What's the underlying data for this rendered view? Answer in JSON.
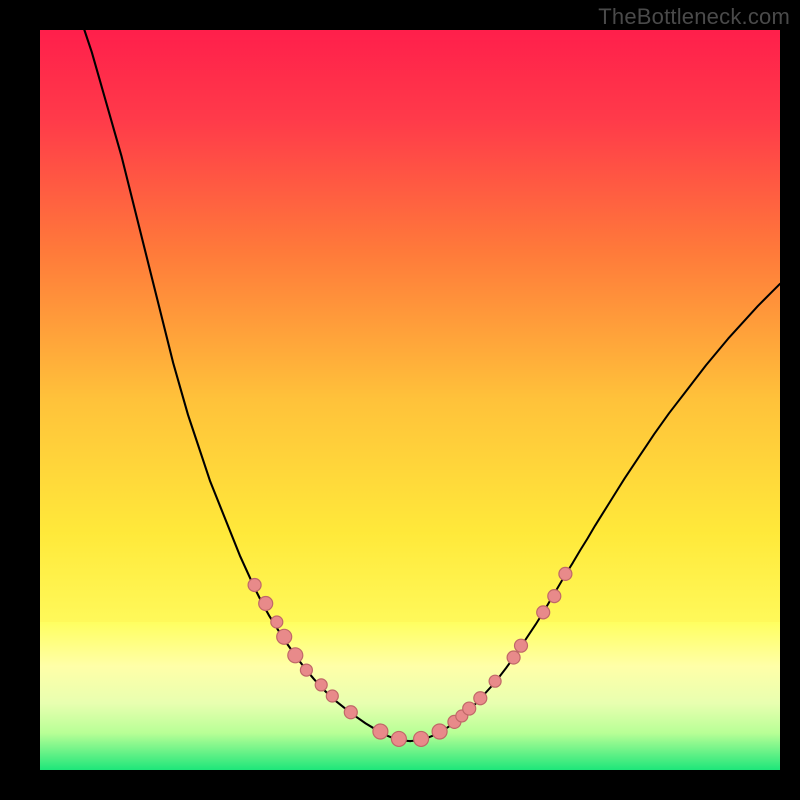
{
  "watermark": "TheBottleneck.com",
  "chart_data": {
    "type": "line",
    "title": "",
    "xlabel": "",
    "ylabel": "",
    "xlim": [
      0,
      100
    ],
    "ylim": [
      0,
      100
    ],
    "background_gradient": {
      "stops": [
        {
          "offset": 0.0,
          "color": "#ff1f4b"
        },
        {
          "offset": 0.12,
          "color": "#ff3a4a"
        },
        {
          "offset": 0.3,
          "color": "#ff7a3a"
        },
        {
          "offset": 0.5,
          "color": "#ffc23a"
        },
        {
          "offset": 0.68,
          "color": "#ffe93a"
        },
        {
          "offset": 0.8,
          "color": "#fff95a"
        },
        {
          "offset": 0.86,
          "color": "#ffffa8"
        },
        {
          "offset": 0.9,
          "color": "#f8ffc0"
        },
        {
          "offset": 0.93,
          "color": "#d9ffb0"
        },
        {
          "offset": 0.96,
          "color": "#9cff8a"
        },
        {
          "offset": 1.0,
          "color": "#1ee67a"
        }
      ]
    },
    "strong_band": {
      "y_top_frac": 0.8,
      "stops": [
        {
          "offset": 0.0,
          "color": "#ffff60"
        },
        {
          "offset": 0.3,
          "color": "#ffffa8"
        },
        {
          "offset": 0.55,
          "color": "#e8ffb0"
        },
        {
          "offset": 0.75,
          "color": "#b8ff96"
        },
        {
          "offset": 1.0,
          "color": "#1ee67a"
        }
      ]
    },
    "series": [
      {
        "name": "left-curve",
        "stroke": "#000000",
        "stroke_width": 2.1,
        "points": [
          [
            6,
            100
          ],
          [
            7,
            97
          ],
          [
            8,
            93.5
          ],
          [
            9,
            90
          ],
          [
            10,
            86.5
          ],
          [
            11,
            83
          ],
          [
            12,
            79
          ],
          [
            13,
            75
          ],
          [
            14,
            71
          ],
          [
            15,
            67
          ],
          [
            16,
            63
          ],
          [
            17,
            59
          ],
          [
            18,
            55
          ],
          [
            19,
            51.5
          ],
          [
            20,
            48
          ],
          [
            21,
            45
          ],
          [
            22,
            42
          ],
          [
            23,
            39
          ],
          [
            24,
            36.5
          ],
          [
            25,
            34
          ],
          [
            26,
            31.5
          ],
          [
            27,
            29
          ],
          [
            28,
            26.8
          ],
          [
            29,
            24.6
          ],
          [
            30,
            22.6
          ],
          [
            31,
            20.8
          ],
          [
            32,
            19.2
          ],
          [
            33,
            17.6
          ],
          [
            34,
            16.2
          ],
          [
            35,
            14.8
          ],
          [
            36,
            13.5
          ],
          [
            37,
            12.3
          ],
          [
            38,
            11.2
          ],
          [
            39,
            10.2
          ],
          [
            40,
            9.3
          ],
          [
            41,
            8.5
          ],
          [
            42,
            7.7
          ],
          [
            43,
            7.0
          ],
          [
            44,
            6.3
          ],
          [
            45,
            5.7
          ],
          [
            46,
            5.1
          ],
          [
            47,
            4.6
          ],
          [
            48,
            4.2
          ],
          [
            49,
            4.0
          ],
          [
            50,
            3.9
          ]
        ]
      },
      {
        "name": "right-curve",
        "stroke": "#000000",
        "stroke_width": 2.0,
        "points": [
          [
            50,
            3.9
          ],
          [
            51,
            4.0
          ],
          [
            52,
            4.2
          ],
          [
            53,
            4.6
          ],
          [
            54,
            5.1
          ],
          [
            55,
            5.7
          ],
          [
            56,
            6.4
          ],
          [
            57,
            7.2
          ],
          [
            58,
            8.1
          ],
          [
            59,
            9.1
          ],
          [
            60,
            10.2
          ],
          [
            61,
            11.3
          ],
          [
            62,
            12.5
          ],
          [
            63,
            13.8
          ],
          [
            64,
            15.2
          ],
          [
            65,
            16.7
          ],
          [
            66,
            18.2
          ],
          [
            67,
            19.7
          ],
          [
            68,
            21.3
          ],
          [
            69,
            23.0
          ],
          [
            70,
            24.7
          ],
          [
            71,
            26.4
          ],
          [
            72,
            28.0
          ],
          [
            73,
            29.7
          ],
          [
            74,
            31.3
          ],
          [
            75,
            33.0
          ],
          [
            76,
            34.6
          ],
          [
            77,
            36.2
          ],
          [
            78,
            37.8
          ],
          [
            79,
            39.4
          ],
          [
            80,
            40.9
          ],
          [
            81,
            42.4
          ],
          [
            82,
            43.9
          ],
          [
            83,
            45.4
          ],
          [
            84,
            46.8
          ],
          [
            85,
            48.2
          ],
          [
            86,
            49.5
          ],
          [
            87,
            50.8
          ],
          [
            88,
            52.1
          ],
          [
            89,
            53.4
          ],
          [
            90,
            54.7
          ],
          [
            91,
            55.9
          ],
          [
            92,
            57.1
          ],
          [
            93,
            58.3
          ],
          [
            94,
            59.4
          ],
          [
            95,
            60.5
          ],
          [
            96,
            61.6
          ],
          [
            97,
            62.7
          ],
          [
            98,
            63.7
          ],
          [
            99,
            64.7
          ],
          [
            100,
            65.7
          ]
        ]
      }
    ],
    "markers": {
      "fill": "#e88a8a",
      "stroke": "#c06868",
      "stroke_width": 1.2,
      "points": [
        {
          "x": 29.0,
          "y": 25.0,
          "r": 6.5
        },
        {
          "x": 30.5,
          "y": 22.5,
          "r": 7.0
        },
        {
          "x": 32.0,
          "y": 20.0,
          "r": 6.0
        },
        {
          "x": 33.0,
          "y": 18.0,
          "r": 7.5
        },
        {
          "x": 34.5,
          "y": 15.5,
          "r": 7.5
        },
        {
          "x": 36.0,
          "y": 13.5,
          "r": 6.0
        },
        {
          "x": 38.0,
          "y": 11.5,
          "r": 6.0
        },
        {
          "x": 39.5,
          "y": 10.0,
          "r": 6.0
        },
        {
          "x": 42.0,
          "y": 7.8,
          "r": 6.5
        },
        {
          "x": 46.0,
          "y": 5.2,
          "r": 7.5
        },
        {
          "x": 48.5,
          "y": 4.2,
          "r": 7.5
        },
        {
          "x": 51.5,
          "y": 4.2,
          "r": 7.5
        },
        {
          "x": 54.0,
          "y": 5.2,
          "r": 7.5
        },
        {
          "x": 56.0,
          "y": 6.5,
          "r": 6.5
        },
        {
          "x": 57.0,
          "y": 7.3,
          "r": 6.0
        },
        {
          "x": 58.0,
          "y": 8.3,
          "r": 6.5
        },
        {
          "x": 59.5,
          "y": 9.7,
          "r": 6.5
        },
        {
          "x": 61.5,
          "y": 12.0,
          "r": 6.0
        },
        {
          "x": 64.0,
          "y": 15.2,
          "r": 6.5
        },
        {
          "x": 65.0,
          "y": 16.8,
          "r": 6.5
        },
        {
          "x": 68.0,
          "y": 21.3,
          "r": 6.5
        },
        {
          "x": 69.5,
          "y": 23.5,
          "r": 6.5
        },
        {
          "x": 71.0,
          "y": 26.5,
          "r": 6.5
        }
      ]
    }
  }
}
